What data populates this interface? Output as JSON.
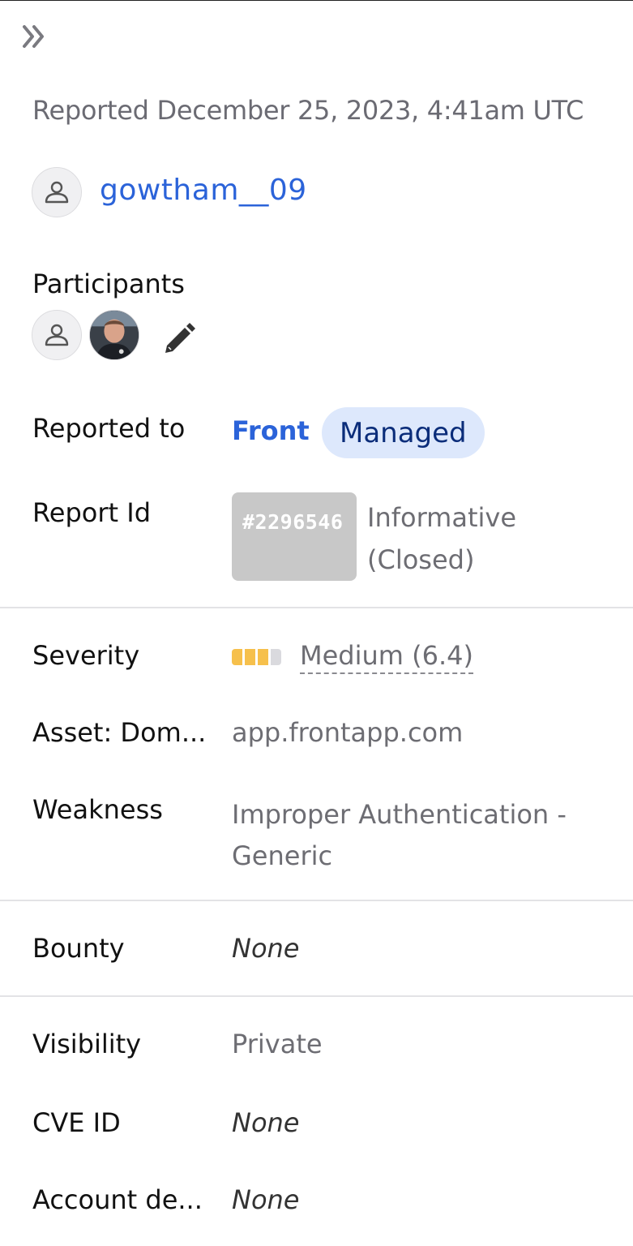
{
  "header": {
    "reported": "Reported December 25, 2023, 4:41am UTC"
  },
  "reporter": {
    "username": "gowtham__09"
  },
  "participants": {
    "label": "Participants"
  },
  "details": {
    "reported_to_label": "Reported to",
    "program": "Front",
    "program_badge": "Managed",
    "report_id_label": "Report Id",
    "report_id": "#2296546",
    "state": "Informative (Closed)",
    "severity_label": "Severity",
    "severity": "Medium (6.4)",
    "severity_level_filled": 3,
    "severity_level_total": 4,
    "asset_label": "Asset: Dom...",
    "asset": "app.frontapp.com",
    "weakness_label": "Weakness",
    "weakness": "Improper Authentication - Generic",
    "bounty_label": "Bounty",
    "bounty": "None",
    "visibility_label": "Visibility",
    "visibility": "Private",
    "cve_label": "CVE ID",
    "cve": "None",
    "account_label": "Account de...",
    "account": "None"
  },
  "colors": {
    "link": "#2b63d9",
    "severity_medium": "#f6c04c",
    "badge_bg": "#dde8fc"
  }
}
